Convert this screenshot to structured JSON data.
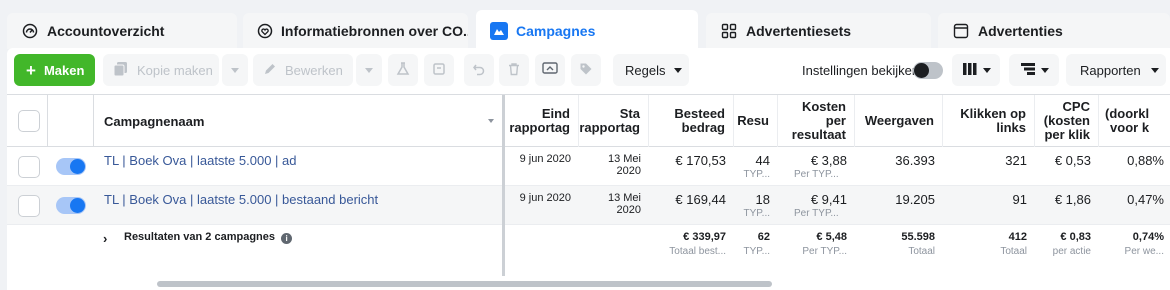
{
  "tabs": [
    {
      "label": "Accountoverzicht",
      "icon": "dashboard-icon"
    },
    {
      "label": "Informatiebronnen over CO...",
      "icon": "heart-shield-icon"
    },
    {
      "label": "Campagnes",
      "icon": "folder-icon"
    },
    {
      "label": "Advertentiesets",
      "icon": "grid-icon"
    },
    {
      "label": "Advertenties",
      "icon": "ad-window-icon"
    }
  ],
  "toolbar": {
    "create_label": "Maken",
    "duplicate_label": "Kopie maken",
    "edit_label": "Bewerken",
    "rules_label": "Regels",
    "view_settings_label": "Instellingen bekijken",
    "reports_label": "Rapporten"
  },
  "columns": {
    "name": "Campagnenaam",
    "end_1": "Eind",
    "end_2": "rapportag",
    "start_1": "Sta",
    "start_2": "rapportag",
    "spent_1": "Besteed",
    "spent_2": "bedrag",
    "results": "Resu",
    "cost_1": "Kosten",
    "cost_2": "per",
    "cost_3": "resultaat",
    "impressions": "Weergaven",
    "clicks_1": "Klikken op",
    "clicks_2": "links",
    "cpc_1": "CPC",
    "cpc_2": "(kosten",
    "cpc_3": "per klik",
    "ctr_1": "(doorkl",
    "ctr_2": "voor k"
  },
  "rows": [
    {
      "name": "TL | Boek Ova | laatste 5.000 | ad",
      "end": "9 jun 2020",
      "start_1": "13 Mei",
      "start_2": "2020",
      "spent": "€ 170,53",
      "results": "44",
      "results_sub": "TYP...",
      "cost": "€ 3,88",
      "cost_sub": "Per TYP...",
      "impressions": "36.393",
      "clicks": "321",
      "cpc": "€ 0,53",
      "ctr": "0,88%"
    },
    {
      "name": "TL | Boek Ova | laatste 5.000 | bestaand bericht",
      "end": "9 jun 2020",
      "start_1": "13 Mei",
      "start_2": "2020",
      "spent": "€ 169,44",
      "results": "18",
      "results_sub": "TYP...",
      "cost": "€ 9,41",
      "cost_sub": "Per TYP...",
      "impressions": "19.205",
      "clicks": "91",
      "cpc": "€ 1,86",
      "ctr": "0,47%"
    }
  ],
  "totals": {
    "label": "Resultaten van 2 campagnes",
    "spent": "€ 339,97",
    "spent_sub": "Totaal best...",
    "results": "62",
    "results_sub": "TYP...",
    "cost": "€ 5,48",
    "cost_sub": "Per TYP...",
    "impressions": "55.598",
    "impressions_sub": "Totaal",
    "clicks": "412",
    "clicks_sub": "Totaal",
    "cpc": "€ 0,83",
    "cpc_sub": "per actie",
    "ctr": "0,74%",
    "ctr_sub": "Per we..."
  },
  "colors": {
    "accent": "#1877f2",
    "create_green": "#42b72a",
    "link": "#385898"
  }
}
